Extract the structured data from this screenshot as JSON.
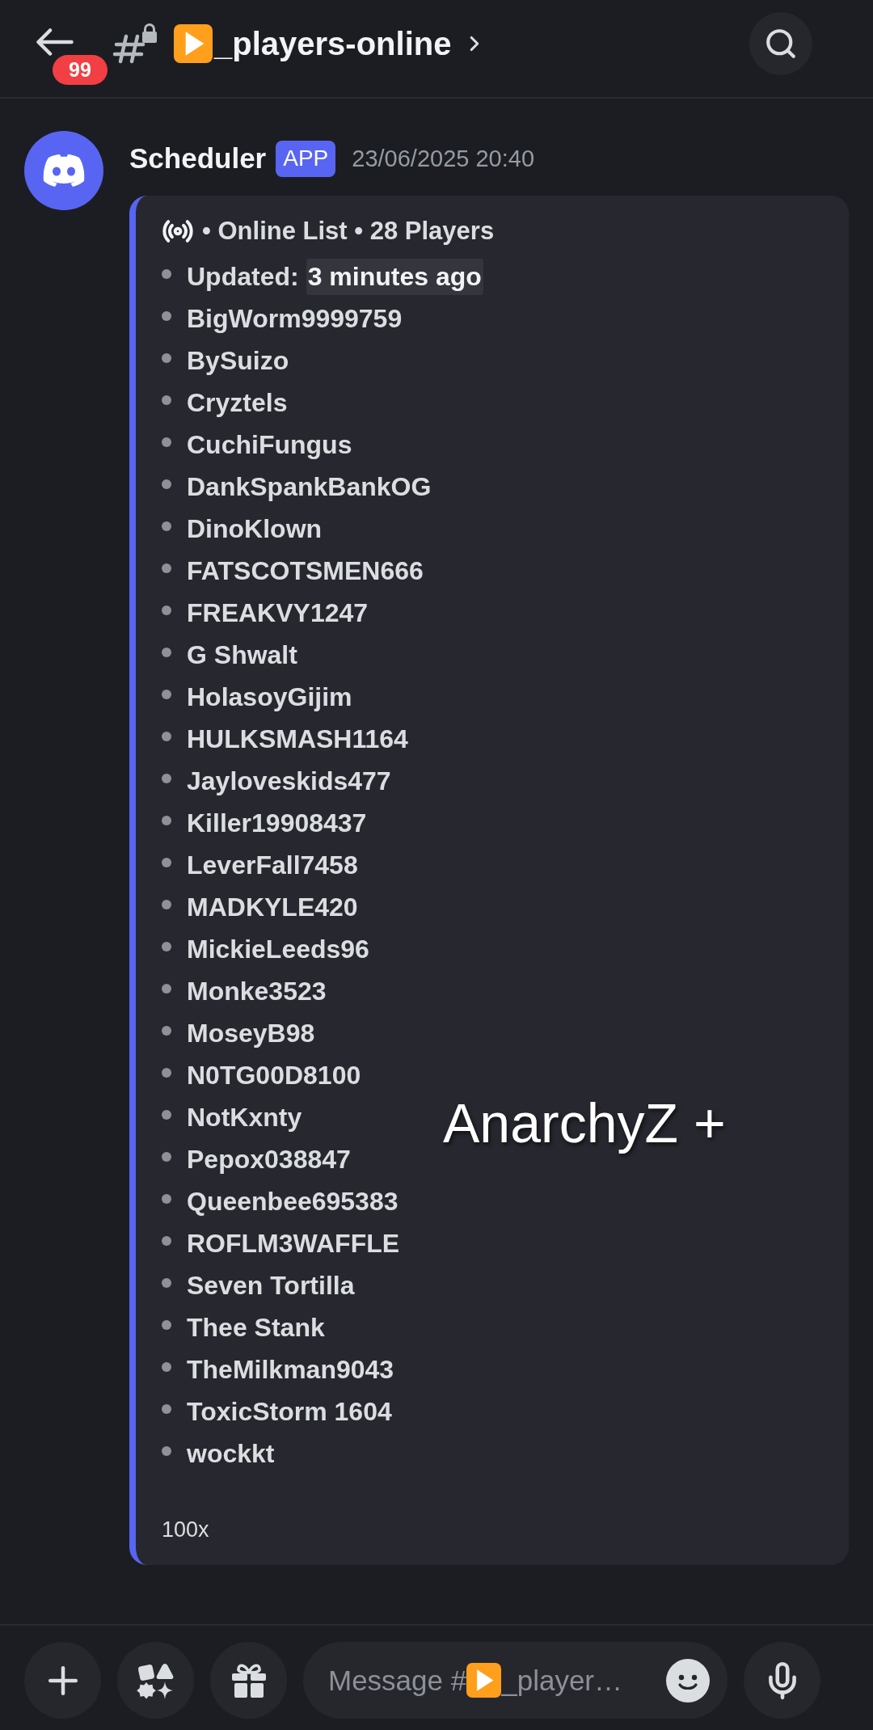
{
  "header": {
    "badge": "99",
    "channel": "_players-online"
  },
  "message": {
    "author": "Scheduler",
    "tag": "APP",
    "timestamp": "23/06/2025 20:40",
    "embed": {
      "title": "• Online List • 28 Players",
      "updated": {
        "label": "Updated:",
        "value": "3 minutes ago"
      },
      "players": [
        "BigWorm9999759",
        "BySuizo",
        "Cryztels",
        "CuchiFungus",
        "DankSpankBankOG",
        "DinoKlown",
        "FATSCOTSMEN666",
        "FREAKVY1247",
        "G Shwalt",
        "HolasoyGijim",
        "HULKSMASH1164",
        "Jayloveskids477",
        "Killer19908437",
        "LeverFall7458",
        "MADKYLE420",
        "MickieLeeds96",
        "Monke3523",
        "MoseyB98",
        "N0TG00D8100",
        "NotKxnty",
        "Pepox038847",
        "Queenbee695383",
        "ROFLM3WAFFLE",
        "Seven Tortilla",
        "Thee Stank",
        "TheMilkman9043",
        "ToxicStorm 1604",
        "wockkt"
      ],
      "footer": "100x",
      "overlay_text": "AnarchyZ +"
    }
  },
  "composer": {
    "placeholder_parts": [
      "Message #",
      "_player…"
    ]
  }
}
